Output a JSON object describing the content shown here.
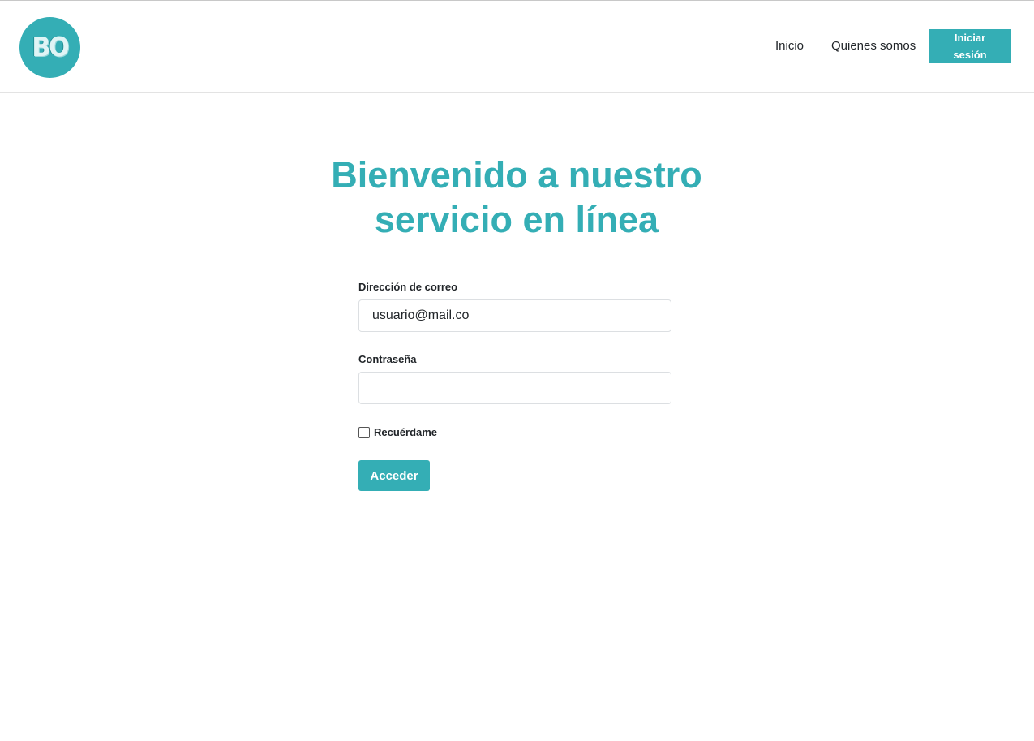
{
  "header": {
    "logo_text": "BO",
    "nav": {
      "home": "Inicio",
      "about": "Quienes somos",
      "login": "Iniciar sesión"
    }
  },
  "main": {
    "title": "Bienvenido a nuestro servicio en línea",
    "form": {
      "email_label": "Dirección de correo",
      "email_value": "usuario@mail.co",
      "password_label": "Contraseña",
      "password_value": "",
      "remember_label": "Recuérdame",
      "remember_checked": false,
      "submit_label": "Acceder"
    }
  },
  "colors": {
    "accent": "#34aeb5",
    "text": "#212529"
  }
}
